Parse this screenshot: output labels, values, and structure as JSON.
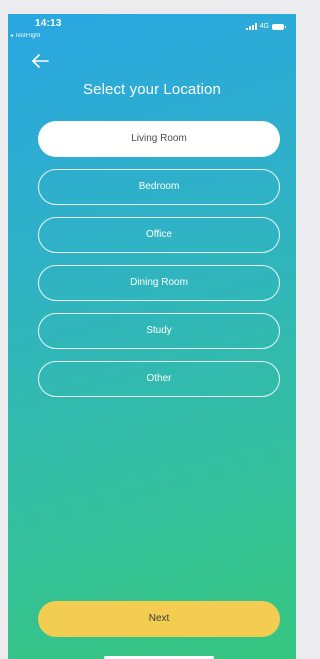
{
  "status_bar": {
    "time": "14:13",
    "back_app": "◂ TestFlight",
    "network": "4G"
  },
  "header": {
    "back_icon": "arrow-left-icon",
    "title": "Select your Location"
  },
  "locations": [
    {
      "label": "Living Room",
      "selected": true
    },
    {
      "label": "Bedroom",
      "selected": false
    },
    {
      "label": "Office",
      "selected": false
    },
    {
      "label": "Dining Room",
      "selected": false
    },
    {
      "label": "Study",
      "selected": false
    },
    {
      "label": "Other",
      "selected": false
    }
  ],
  "footer": {
    "next_label": "Next"
  },
  "colors": {
    "gradient_top": "#2aa6e2",
    "gradient_bottom": "#37c67f",
    "next_button": "#f2cd52",
    "selected_option_bg": "#ffffff"
  }
}
